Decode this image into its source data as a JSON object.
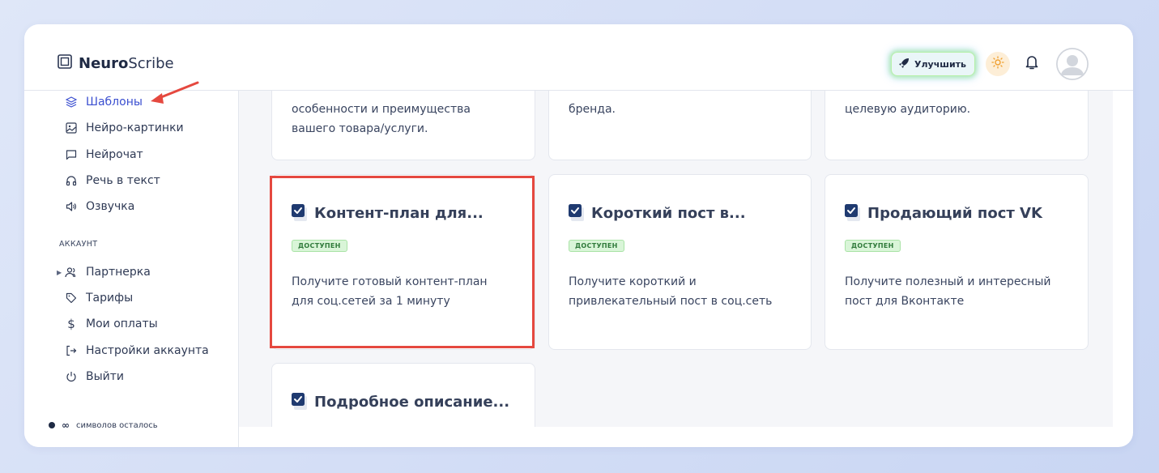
{
  "header": {
    "logo_bold": "Neuro",
    "logo_rest": "Scribe",
    "upgrade_label": "Улучшить"
  },
  "sidebar": {
    "items": [
      {
        "label": "Шаблоны",
        "icon": "layers-icon",
        "active": true
      },
      {
        "label": "Нейро-картинки",
        "icon": "image-icon"
      },
      {
        "label": "Нейрочат",
        "icon": "chat-icon"
      },
      {
        "label": "Речь в текст",
        "icon": "headphones-icon"
      },
      {
        "label": "Озвучка",
        "icon": "speaker-icon"
      }
    ],
    "account_label": "АККАУНТ",
    "account_items": [
      {
        "label": "Партнерка",
        "icon": "users-icon"
      },
      {
        "label": "Тарифы",
        "icon": "tag-icon"
      },
      {
        "label": "Мои оплаты",
        "icon": "dollar-icon"
      },
      {
        "label": "Настройки аккаунта",
        "icon": "login-icon"
      },
      {
        "label": "Выйти",
        "icon": "power-icon"
      }
    ],
    "chars_left_label": "символов осталось",
    "chars_left_value": "∞"
  },
  "cards_top": [
    {
      "text_line1": "особенности и преимущества",
      "text_line2": "вашего товара/услуги."
    },
    {
      "text_line1": "бренда.",
      "text_line2": ""
    },
    {
      "text_line1": "целевую аудиторию.",
      "text_line2": ""
    }
  ],
  "cards": [
    {
      "title": "Контент-план для...",
      "badge": "ДОСТУПЕН",
      "desc": "Получите готовый контент-план для соц.сетей за 1 минуту"
    },
    {
      "title": "Короткий пост в...",
      "badge": "ДОСТУПЕН",
      "desc": "Получите короткий и привлекательный пост в соц.сеть"
    },
    {
      "title": "Продающий пост VK",
      "badge": "ДОСТУПЕН",
      "desc": "Получите полезный и интересный пост для Вконтакте"
    },
    {
      "title": "Подробное описание..."
    }
  ],
  "colors": {
    "accent": "#3b4fd0",
    "highlight": "#e5483f",
    "badge_bg": "#d9f5d8"
  }
}
